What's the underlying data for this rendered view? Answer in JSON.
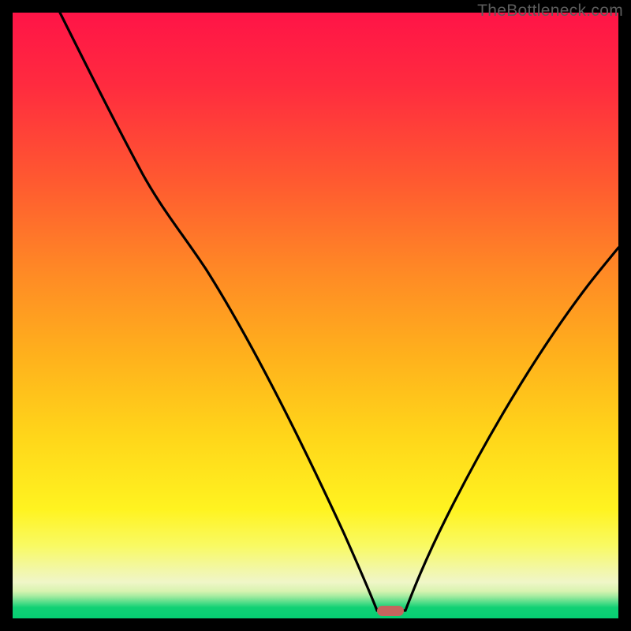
{
  "watermark": "TheBottleneck.com",
  "colors": {
    "background": "#000000",
    "gradient_top": "#ff1447",
    "gradient_mid": "#ffd61a",
    "gradient_bottom": "#06cf73",
    "curve": "#000000",
    "marker": "#c5655e"
  },
  "chart_data": {
    "type": "line",
    "title": "",
    "subtitle": "",
    "xlabel": "",
    "ylabel": "",
    "xlim": [
      0,
      100
    ],
    "ylim": [
      0,
      100
    ],
    "grid": false,
    "legend": false,
    "annotations": [
      {
        "text": "TheBottleneck.com",
        "position": "top-right"
      }
    ],
    "series": [
      {
        "name": "bottleneck-curve",
        "x": [
          0,
          7,
          14,
          20,
          27,
          33,
          40,
          47,
          53,
          58,
          60,
          62,
          64,
          67,
          73,
          80,
          87,
          93,
          100
        ],
        "values": [
          100,
          90,
          80,
          72,
          61,
          50,
          38,
          24,
          10,
          2,
          0,
          0,
          0,
          3,
          12,
          25,
          38,
          48,
          58
        ]
      }
    ],
    "marker": {
      "x": 62,
      "y": 0,
      "width_pct": 4.4,
      "height_pct": 1.7
    }
  }
}
